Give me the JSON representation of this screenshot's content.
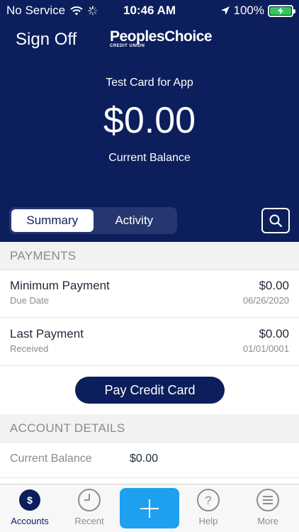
{
  "status_bar": {
    "carrier": "No Service",
    "time": "10:46 AM",
    "battery": "100%"
  },
  "header": {
    "sign_off_label": "Sign Off",
    "brand_name": "PeoplesChoice",
    "brand_sub": "CREDIT UNION",
    "card_name": "Test Card for App",
    "balance": "$0.00",
    "balance_label": "Current Balance"
  },
  "tabs": {
    "summary": "Summary",
    "activity": "Activity",
    "selected": "Summary"
  },
  "payments": {
    "section_title": "PAYMENTS",
    "rows": [
      {
        "title": "Minimum Payment",
        "subtitle": "Due Date",
        "amount": "$0.00",
        "date": "06/26/2020"
      },
      {
        "title": "Last Payment",
        "subtitle": "Received",
        "amount": "$0.00",
        "date": "01/01/0001"
      }
    ],
    "pay_button_label": "Pay Credit Card"
  },
  "account_details": {
    "section_title": "ACCOUNT DETAILS",
    "rows": [
      {
        "label": "Current Balance",
        "value": "$0.00"
      }
    ]
  },
  "tabbar": {
    "items": [
      {
        "label": "Accounts",
        "icon": "dollar-circle-icon"
      },
      {
        "label": "Recent",
        "icon": "clock-icon"
      },
      {
        "label": "",
        "icon": "plus-icon"
      },
      {
        "label": "Help",
        "icon": "question-icon"
      },
      {
        "label": "More",
        "icon": "menu-icon"
      }
    ],
    "selected": "Accounts"
  },
  "colors": {
    "navy": "#0c1e5b",
    "accent_blue": "#1ea0f0",
    "battery_green": "#34c759"
  }
}
